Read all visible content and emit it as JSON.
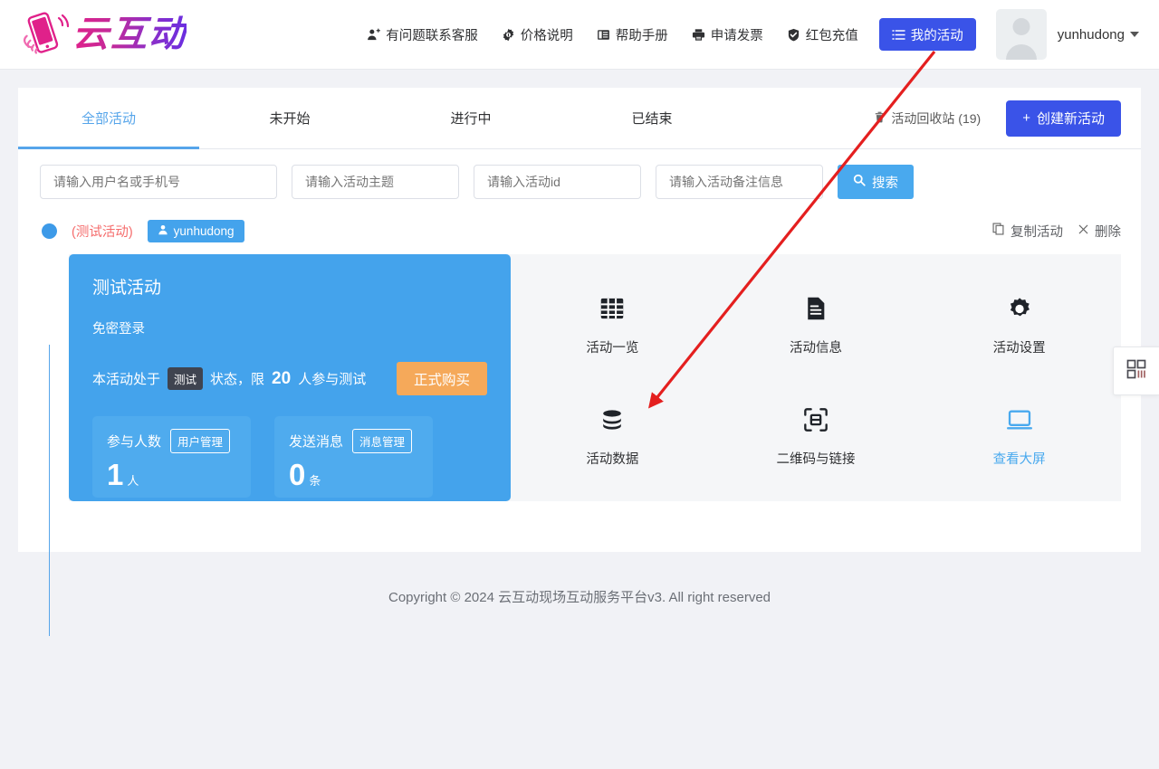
{
  "header": {
    "logo_text": "云互动",
    "logo_icon": "hand-holding-phone-icon",
    "nav": [
      {
        "label": "有问题联系客服",
        "icon": "user-support-icon"
      },
      {
        "label": "价格说明",
        "icon": "gear-info-icon"
      },
      {
        "label": "帮助手册",
        "icon": "book-icon"
      },
      {
        "label": "申请发票",
        "icon": "printer-icon"
      },
      {
        "label": "红包充值",
        "icon": "shield-check-icon"
      }
    ],
    "primary_nav": {
      "label": "我的活动",
      "icon": "list-icon"
    },
    "user": {
      "name": "yunhudong",
      "avatar_icon": "user-avatar-placeholder",
      "caret_icon": "chevron-down-icon"
    }
  },
  "tabs": [
    {
      "label": "全部活动",
      "active": true
    },
    {
      "label": "未开始",
      "active": false
    },
    {
      "label": "进行中",
      "active": false
    },
    {
      "label": "已结束",
      "active": false
    }
  ],
  "recycle_bin": {
    "label": "活动回收站 (19)",
    "icon": "trash-icon"
  },
  "create_button": {
    "label": "创建新活动",
    "icon": "plus-icon"
  },
  "search": {
    "username_placeholder": "请输入用户名或手机号",
    "subject_placeholder": "请输入活动主题",
    "activity_id_placeholder": "请输入活动id",
    "remark_placeholder": "请输入活动备注信息",
    "button_label": "搜索",
    "button_icon": "search-icon",
    "username_value": "",
    "subject_value": "",
    "activity_id_value": "",
    "remark_value": ""
  },
  "activity": {
    "status_dot": "status-dot-blue",
    "test_label": "(测试活动)",
    "owner": "yunhudong",
    "owner_icon": "user-icon",
    "actions": [
      {
        "label": "复制活动",
        "icon": "copy-icon"
      },
      {
        "label": "删除",
        "icon": "close-icon"
      }
    ],
    "card": {
      "title": "测试活动",
      "subtitle": "免密登录",
      "status_prefix": "本活动处于",
      "status_tag": "测试",
      "status_middle": "状态，限",
      "status_number": "20",
      "status_suffix": "人参与测试",
      "buy_button": "正式购买",
      "stats": [
        {
          "title": "参与人数",
          "action": "用户管理",
          "value": "1",
          "unit": "人"
        },
        {
          "title": "发送消息",
          "action": "消息管理",
          "value": "0",
          "unit": "条"
        }
      ]
    },
    "tools": [
      {
        "label": "活动一览",
        "icon": "grid-icon",
        "accent": false
      },
      {
        "label": "活动信息",
        "icon": "document-icon",
        "accent": false
      },
      {
        "label": "活动设置",
        "icon": "gear-icon",
        "accent": false
      },
      {
        "label": "活动数据",
        "icon": "database-icon",
        "accent": false
      },
      {
        "label": "二维码与链接",
        "icon": "qr-scan-icon",
        "accent": false
      },
      {
        "label": "查看大屏",
        "icon": "monitor-icon",
        "accent": true
      }
    ]
  },
  "side_float": {
    "icon": "qr-code-icon"
  },
  "footer": {
    "text": "Copyright © 2024 云互动现场互动服务平台v3. All right reserved"
  },
  "annotation": {
    "color": "#e41f1f",
    "from_label": "我的活动",
    "to_label": "活动数据"
  },
  "colors": {
    "brand_blue": "#3a53e8",
    "accent_blue": "#49a9ee",
    "card_blue": "#44a3ec",
    "orange": "#f5a95a",
    "red": "#f56c6c",
    "page_bg": "#f1f2f6"
  }
}
